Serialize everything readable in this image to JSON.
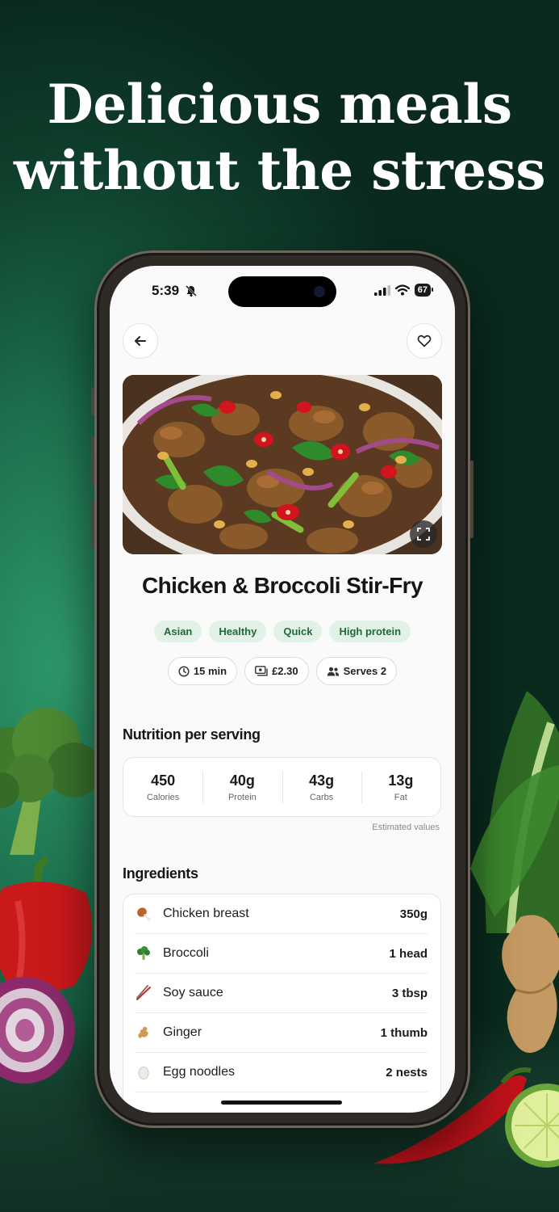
{
  "headline": {
    "line1": "Delicious meals",
    "line2": "without the stress"
  },
  "status_bar": {
    "time": "5:39",
    "battery": "67"
  },
  "recipe": {
    "title": "Chicken & Broccoli Stir-Fry",
    "tags": [
      "Asian",
      "Healthy",
      "Quick",
      "High protein"
    ],
    "meta": {
      "time": "15 min",
      "cost": "£2.30",
      "serves": "Serves 2"
    }
  },
  "nutrition": {
    "heading": "Nutrition per serving",
    "items": [
      {
        "value": "450",
        "label": "Calories"
      },
      {
        "value": "40g",
        "label": "Protein"
      },
      {
        "value": "43g",
        "label": "Carbs"
      },
      {
        "value": "13g",
        "label": "Fat"
      }
    ],
    "note": "Estimated values"
  },
  "ingredients": {
    "heading": "Ingredients",
    "items": [
      {
        "name": "Chicken breast",
        "qty": "350g",
        "icon": "chicken-leg-icon"
      },
      {
        "name": "Broccoli",
        "qty": "1 head",
        "icon": "broccoli-icon"
      },
      {
        "name": "Soy sauce",
        "qty": "3 tbsp",
        "icon": "chopsticks-icon"
      },
      {
        "name": "Ginger",
        "qty": "1 thumb",
        "icon": "ginger-icon"
      },
      {
        "name": "Egg noodles",
        "qty": "2 nests",
        "icon": "egg-icon"
      }
    ]
  },
  "colors": {
    "tag_bg": "#e2f2e6",
    "tag_text": "#1d6b3b",
    "background_green": "#1c6e4c"
  }
}
